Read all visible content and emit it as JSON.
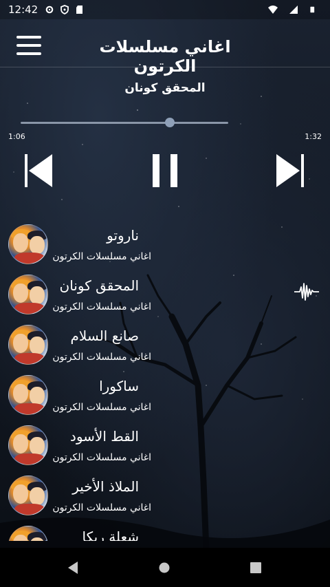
{
  "status_bar": {
    "time": "12:42",
    "left_icons": [
      "gear-icon",
      "shield-icon",
      "sd-card-icon"
    ],
    "right_icons": [
      "wifi-icon",
      "signal-icon",
      "battery-icon"
    ]
  },
  "app_bar": {
    "title": "اغاني مسلسلات الكرتون",
    "menu_icon": "menu-icon"
  },
  "player": {
    "now_playing_title": "المحقق كونان",
    "elapsed": "1:06",
    "duration": "1:32",
    "progress_fraction": 0.717,
    "controls": [
      "skip-previous-icon",
      "pause-icon",
      "skip-next-icon"
    ]
  },
  "playlist": [
    {
      "title": "ناروتو",
      "subtitle": "اغاني مسلسلات الكرتون",
      "playing": false
    },
    {
      "title": "المحقق  كونان",
      "subtitle": "اغاني مسلسلات الكرتون",
      "playing": true
    },
    {
      "title": "صانع  السلام",
      "subtitle": "اغاني مسلسلات الكرتون",
      "playing": false
    },
    {
      "title": "ساكورا",
      "subtitle": "اغاني مسلسلات الكرتون",
      "playing": false
    },
    {
      "title": "القط  الأسود",
      "subtitle": "اغاني مسلسلات الكرتون",
      "playing": false
    },
    {
      "title": "الملاذ  الأخير",
      "subtitle": "اغاني مسلسلات الكرتون",
      "playing": false
    },
    {
      "title": "شعلة  ريكا",
      "subtitle": "",
      "playing": false
    }
  ],
  "nav_bar": {
    "buttons": [
      "back-icon",
      "home-icon",
      "recents-icon"
    ]
  }
}
